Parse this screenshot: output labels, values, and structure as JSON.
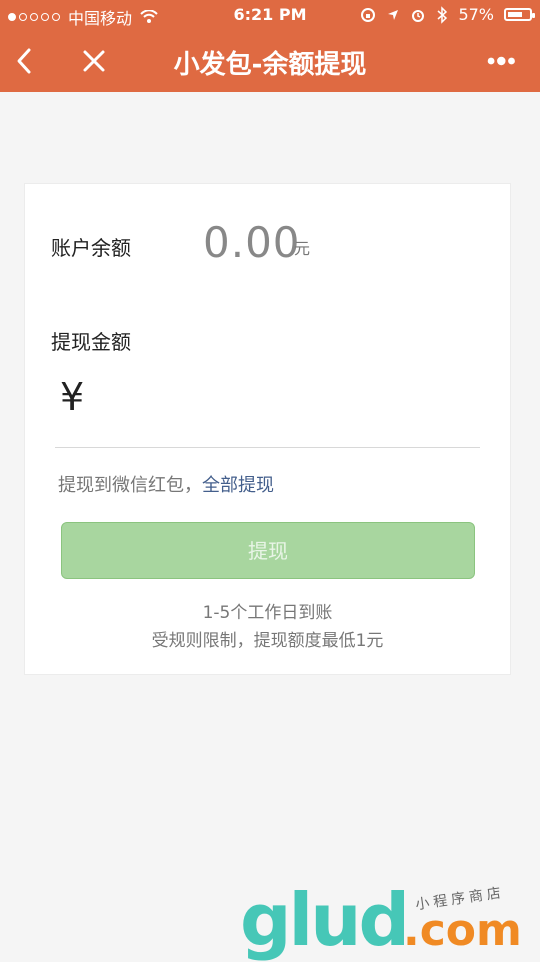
{
  "status_bar": {
    "carrier": "中国移动",
    "time": "6:21 PM",
    "battery": "57%"
  },
  "nav": {
    "title": "小发包-余额提现"
  },
  "balance": {
    "label": "账户余额",
    "value": "0.00",
    "unit": "元"
  },
  "withdraw": {
    "label": "提现金额",
    "currency_symbol": "¥",
    "input_value": "",
    "hint_prefix": "提现到微信红包，",
    "hint_link": "全部提现",
    "button_label": "提现",
    "note1": "1-5个工作日到账",
    "note2": "受规则限制，提现额度最低1元"
  },
  "watermark": {
    "brand": "glud",
    "domain": ".com",
    "tagline": "小程序商店"
  },
  "colors": {
    "header": "#df6a42",
    "button": "#a8d69f",
    "link": "#445f8c"
  }
}
